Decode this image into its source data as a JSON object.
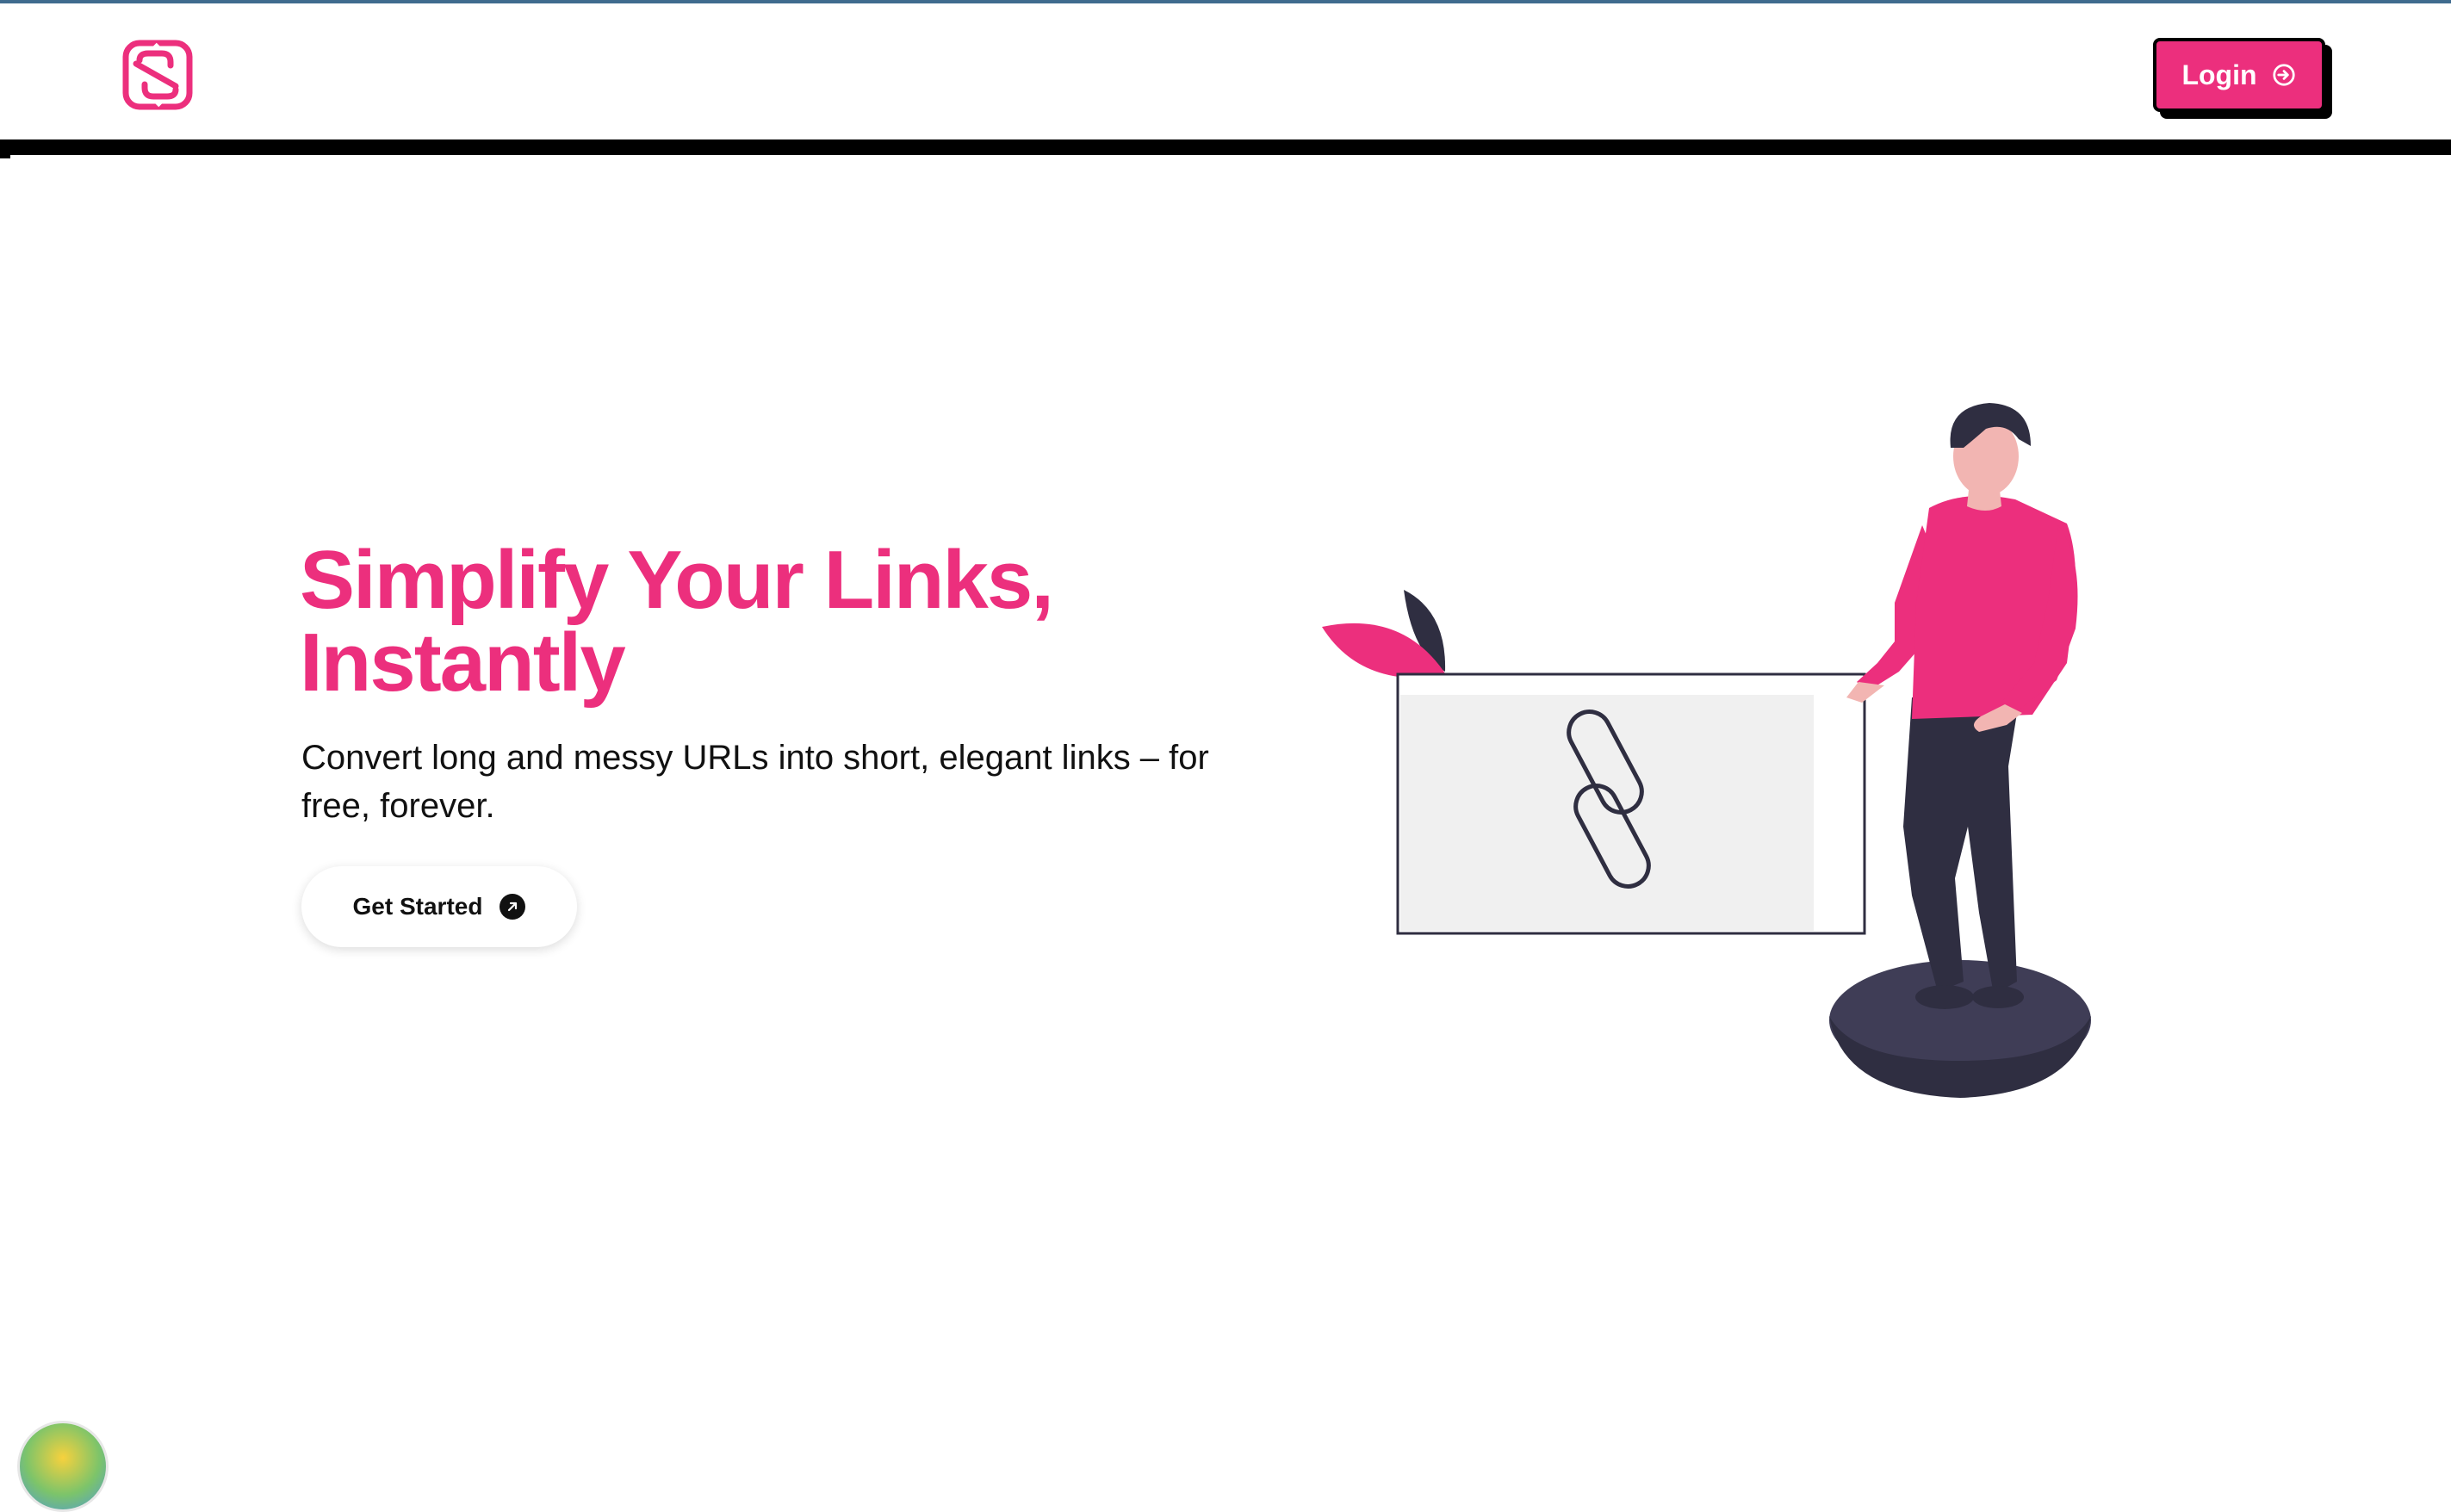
{
  "nav": {
    "logo_icon": "brand-s-logo-icon",
    "login_label": "Login",
    "login_icon": "login-arrow-icon"
  },
  "hero": {
    "headline_line1": "Simplify Your Links,",
    "headline_line2": "Instantly",
    "subtitle": "Convert long and messy URLs into short, elegant links – for free, forever.",
    "cta_label": "Get Started",
    "cta_icon": "arrow-up-right-circle-icon",
    "illustration_icon": "link-chain-icon"
  },
  "colors": {
    "brand_pink": "#ec2f7d",
    "dark_navy": "#2f2e41",
    "panel_gray": "#f0f0f0",
    "skin": "#f2b5b2",
    "border_black": "#000000"
  }
}
